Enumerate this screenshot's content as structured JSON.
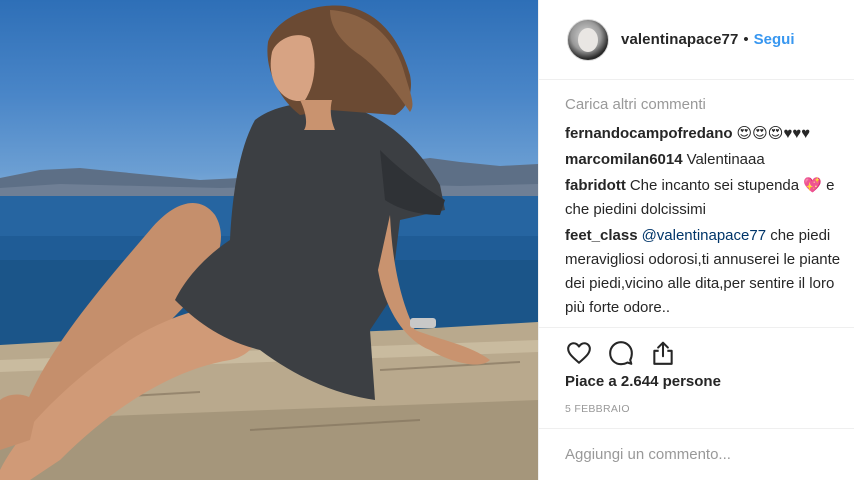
{
  "post": {
    "image_alt": "",
    "header": {
      "username": "valentinapace77",
      "separator": "•",
      "follow_label": "Segui"
    },
    "load_more_label": "Carica altri commenti",
    "comments": [
      {
        "user": "fernandocampofredano",
        "text": "😍😍😍♥♥♥"
      },
      {
        "user": "marcomilan6014",
        "text": "Valentinaaa"
      },
      {
        "user": "fabridott",
        "text": "Che incanto sei stupenda 💖 e che piedini dolcissimi"
      },
      {
        "user": "feet_class",
        "mention": "@valentinapace77",
        "text": " che piedi meravigliosi odorosi,ti annuserei le piante dei piedi,vicino alle dita,per sentire il loro più forte odore.."
      }
    ],
    "actions": {
      "like_icon": "heart-icon",
      "comment_icon": "comment-icon",
      "share_icon": "share-icon"
    },
    "likes_text": "Piace a 2.644 persone",
    "date_text": "5 FEBBRAIO",
    "add_comment_placeholder": "Aggiungi un commento...",
    "colors": {
      "link_blue": "#3897f0",
      "text": "#262626",
      "muted": "#999999",
      "border": "#efefef"
    }
  }
}
